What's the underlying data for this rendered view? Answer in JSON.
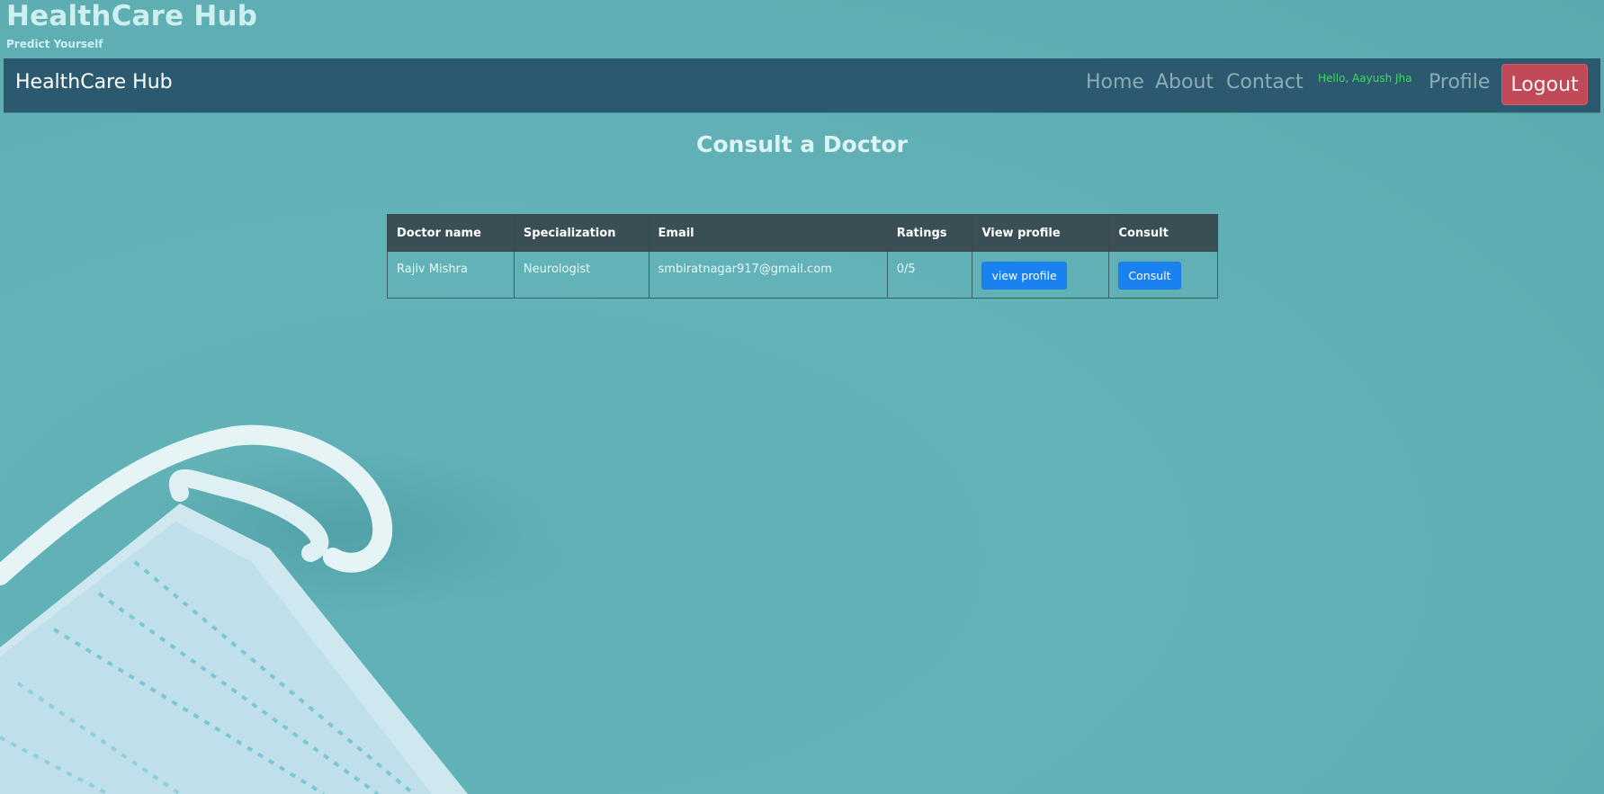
{
  "header": {
    "title": "HealthCare Hub",
    "tagline": "Predict Yourself"
  },
  "navbar": {
    "brand": "HealthCare Hub",
    "links": {
      "home": "Home",
      "about": "About",
      "contact": "Contact",
      "profile": "Profile"
    },
    "greeting": "Hello, Aayush Jha",
    "logout": "Logout"
  },
  "main": {
    "heading": "Consult a Doctor",
    "table": {
      "columns": [
        "Doctor name",
        "Specialization",
        "Email",
        "Ratings",
        "View profile",
        "Consult"
      ],
      "rows": [
        {
          "name": "Rajiv Mishra",
          "specialization": "Neurologist",
          "email": "smbiratnagar917@gmail.com",
          "rating": "0/5",
          "view_button": "view profile",
          "consult_button": "Consult"
        }
      ]
    }
  },
  "colors": {
    "background": "#62b3b8",
    "navbar": "#2b5a70",
    "logout": "#c04a57",
    "greeting": "#3ddc56",
    "button_primary": "#1a82f0",
    "table_header": "#3a4e55"
  },
  "decoration": {
    "background_image": "surgical-mask-photo"
  }
}
